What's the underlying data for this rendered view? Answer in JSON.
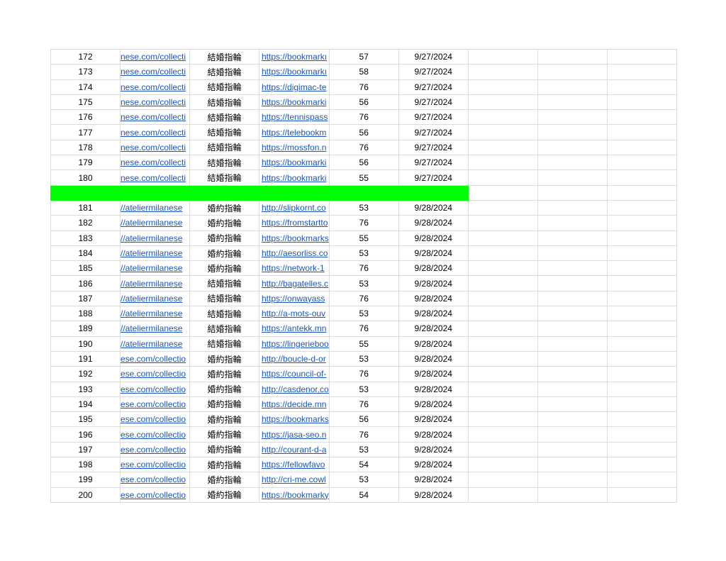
{
  "colors": {
    "link": "#1a55c2",
    "separator": "#00ff00",
    "grid": "#dadce0"
  },
  "rows_a": [
    {
      "n": "172",
      "u": "nese.com/collecti",
      "k": "結婚指輪",
      "l": "https://bookmarkı",
      "d": "57",
      "t": "9/27/2024"
    },
    {
      "n": "173",
      "u": "nese.com/collecti",
      "k": "結婚指輪",
      "l": "https://bookmarkı",
      "d": "58",
      "t": "9/27/2024"
    },
    {
      "n": "174",
      "u": "nese.com/collecti",
      "k": "結婚指輪",
      "l": "https://digimac-te",
      "d": "76",
      "t": "9/27/2024"
    },
    {
      "n": "175",
      "u": "nese.com/collecti",
      "k": "結婚指輪",
      "l": "https://bookmarki",
      "d": "56",
      "t": "9/27/2024"
    },
    {
      "n": "176",
      "u": "nese.com/collecti",
      "k": "結婚指輪",
      "l": "https://tennispass",
      "d": "76",
      "t": "9/27/2024"
    },
    {
      "n": "177",
      "u": "nese.com/collecti",
      "k": "結婚指輪",
      "l": "https://telebookm",
      "d": "56",
      "t": "9/27/2024"
    },
    {
      "n": "178",
      "u": "nese.com/collecti",
      "k": "結婚指輪",
      "l": "https://mossfon.n",
      "d": "76",
      "t": "9/27/2024"
    },
    {
      "n": "179",
      "u": "nese.com/collecti",
      "k": "結婚指輪",
      "l": "https://bookmarki",
      "d": "56",
      "t": "9/27/2024"
    },
    {
      "n": "180",
      "u": "nese.com/collecti",
      "k": "結婚指輪",
      "l": "https://bookmarki",
      "d": "55",
      "t": "9/27/2024"
    }
  ],
  "rows_b": [
    {
      "n": "181",
      "u": "//ateliermilanese",
      "k": "婚約指輪",
      "l": "http://slipkornt.co",
      "d": "53",
      "t": "9/28/2024"
    },
    {
      "n": "182",
      "u": "//ateliermilanese",
      "k": "婚約指輪",
      "l": "https://fromstartto",
      "d": "76",
      "t": "9/28/2024"
    },
    {
      "n": "183",
      "u": "//ateliermilanese",
      "k": "婚約指輪",
      "l": "https://bookmarks",
      "d": "55",
      "t": "9/28/2024"
    },
    {
      "n": "184",
      "u": "//ateliermilanese",
      "k": "婚約指輪",
      "l": "http://aesorliss.co",
      "d": "53",
      "t": "9/28/2024"
    },
    {
      "n": "185",
      "u": "//ateliermilanese",
      "k": "婚約指輪",
      "l": "https://network-1",
      "d": "76",
      "t": "9/28/2024"
    },
    {
      "n": "186",
      "u": "//ateliermilanese",
      "k": "結婚指輪",
      "l": "http://bagatelles.c",
      "d": "53",
      "t": "9/28/2024"
    },
    {
      "n": "187",
      "u": "//ateliermilanese",
      "k": "結婚指輪",
      "l": "https://onwayass",
      "d": "76",
      "t": "9/28/2024"
    },
    {
      "n": "188",
      "u": "//ateliermilanese",
      "k": "結婚指輪",
      "l": "http://a-mots-ouv",
      "d": "53",
      "t": "9/28/2024"
    },
    {
      "n": "189",
      "u": "//ateliermilanese",
      "k": "結婚指輪",
      "l": "https://antekk.mn",
      "d": "76",
      "t": "9/28/2024"
    },
    {
      "n": "190",
      "u": "//ateliermilanese",
      "k": "結婚指輪",
      "l": "https://lingerieboo",
      "d": "55",
      "t": "9/28/2024"
    },
    {
      "n": "191",
      "u": "ese.com/collectio",
      "k": "婚約指輪",
      "l": "http://boucle-d-or",
      "d": "53",
      "t": "9/28/2024"
    },
    {
      "n": "192",
      "u": "ese.com/collectio",
      "k": "婚約指輪",
      "l": "https://council-of-",
      "d": "76",
      "t": "9/28/2024"
    },
    {
      "n": "193",
      "u": "ese.com/collectio",
      "k": "婚約指輪",
      "l": "http://casdenor.co",
      "d": "53",
      "t": "9/28/2024"
    },
    {
      "n": "194",
      "u": "ese.com/collectio",
      "k": "婚約指輪",
      "l": "https://decide.mn",
      "d": "76",
      "t": "9/28/2024"
    },
    {
      "n": "195",
      "u": "ese.com/collectio",
      "k": "婚約指輪",
      "l": "https://bookmarks",
      "d": "56",
      "t": "9/28/2024"
    },
    {
      "n": "196",
      "u": "ese.com/collectio",
      "k": "婚約指輪",
      "l": "https://jasa-seo.n",
      "d": "76",
      "t": "9/28/2024"
    },
    {
      "n": "197",
      "u": "ese.com/collectio",
      "k": "婚約指輪",
      "l": "http://courant-d-a",
      "d": "53",
      "t": "9/28/2024"
    },
    {
      "n": "198",
      "u": "ese.com/collectio",
      "k": "婚約指輪",
      "l": "https://fellowfavo",
      "d": "54",
      "t": "9/28/2024"
    },
    {
      "n": "199",
      "u": "ese.com/collectio",
      "k": "婚約指輪",
      "l": "http://cri-me.cowl",
      "d": "53",
      "t": "9/28/2024"
    },
    {
      "n": "200",
      "u": "ese.com/collectio",
      "k": "婚約指輪",
      "l": "https://bookmarky",
      "d": "54",
      "t": "9/28/2024"
    }
  ]
}
